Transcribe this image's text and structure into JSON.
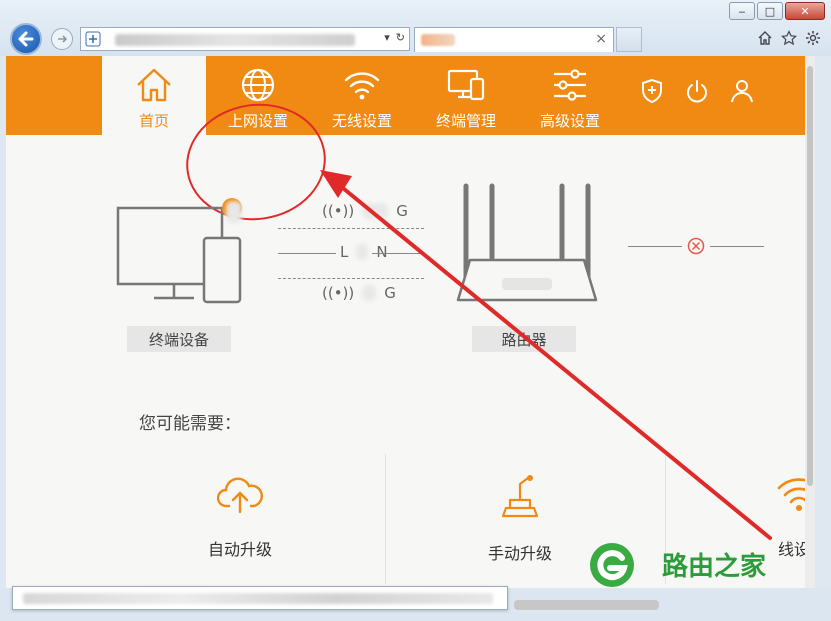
{
  "browser": {
    "tab_close": "×",
    "window_controls": {
      "minimize": "‒",
      "maximize": "□",
      "close": "✕"
    },
    "toolbar_icons": [
      "home-icon",
      "star-icon",
      "gear-icon"
    ]
  },
  "nav": {
    "items": [
      {
        "label": "首页",
        "icon": "home-icon"
      },
      {
        "label": "上网设置",
        "icon": "globe-icon"
      },
      {
        "label": "无线设置",
        "icon": "wifi-icon"
      },
      {
        "label": "终端管理",
        "icon": "devices-icon"
      },
      {
        "label": "高级设置",
        "icon": "sliders-icon"
      }
    ],
    "right_icons": [
      "shield-icon",
      "power-icon",
      "user-icon"
    ],
    "active_index": 0
  },
  "topology": {
    "device_label": "终端设备",
    "router_label": "路由器",
    "band_top": "G",
    "band_mid_left": "L",
    "band_mid_right": "N",
    "band_bottom": "G"
  },
  "suggest": {
    "title": "您可能需要：",
    "items": [
      {
        "label": "自动升级",
        "icon": "cloud-upload-icon"
      },
      {
        "label": "手动升级",
        "icon": "joystick-icon"
      },
      {
        "label": "线设置",
        "icon": "wifi-icon"
      }
    ]
  },
  "watermark": {
    "text": "路由之家"
  },
  "colors": {
    "brand": "#f08a12",
    "annotation": "#e02a2a",
    "watermark": "#2c9b3a"
  }
}
